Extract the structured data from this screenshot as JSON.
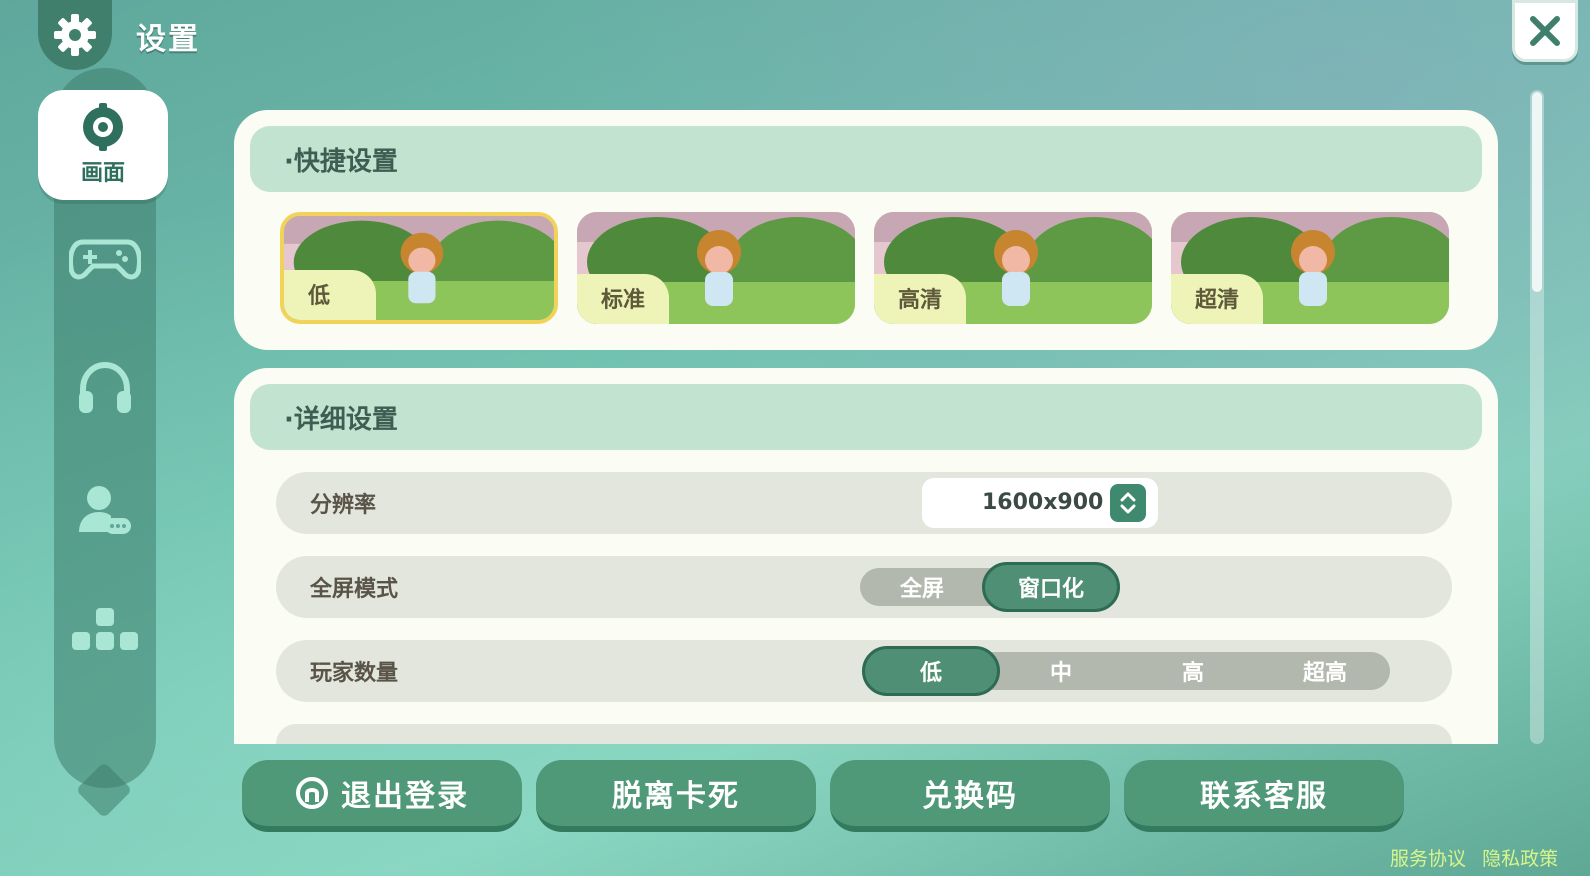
{
  "header": {
    "title": "设置"
  },
  "sidebar": {
    "tabs": [
      {
        "label": "画面",
        "icon": "display-settings-icon",
        "active": true
      },
      {
        "label": "",
        "icon": "gamepad-icon",
        "active": false
      },
      {
        "label": "",
        "icon": "headphones-icon",
        "active": false
      },
      {
        "label": "",
        "icon": "user-chat-icon",
        "active": false
      },
      {
        "label": "",
        "icon": "keyboard-keys-icon",
        "active": false
      }
    ]
  },
  "quick_settings": {
    "title": "·快捷设置",
    "presets": [
      {
        "label": "低",
        "selected": true
      },
      {
        "label": "标准",
        "selected": false
      },
      {
        "label": "高清",
        "selected": false
      },
      {
        "label": "超清",
        "selected": false
      }
    ]
  },
  "detail_settings": {
    "title": "·详细设置",
    "resolution": {
      "label": "分辨率",
      "value": "1600x900"
    },
    "fullscreen": {
      "label": "全屏模式",
      "options": [
        "全屏",
        "窗口化"
      ],
      "selected": "窗口化"
    },
    "player_count": {
      "label": "玩家数量",
      "options": [
        "低",
        "中",
        "高",
        "超高"
      ],
      "selected": "低"
    }
  },
  "bottom_buttons": {
    "logout": "退出登录",
    "unstuck": "脱离卡死",
    "redeem": "兑换码",
    "support": "联系客服"
  },
  "footer": {
    "terms": "服务协议",
    "privacy": "隐私政策"
  },
  "colors": {
    "accent": "#4f9978",
    "selected_border": "#f1d35a",
    "panel": "#fbfcf3"
  }
}
